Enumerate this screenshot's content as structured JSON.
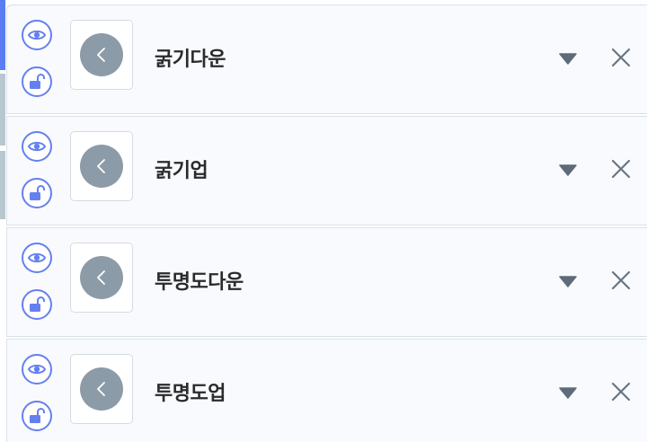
{
  "layers": [
    {
      "label": "굵기다운",
      "visible_icon": "eye-icon",
      "lock_icon": "unlock-icon",
      "thumb_icon": "chevron-left-icon"
    },
    {
      "label": "굵기업",
      "visible_icon": "eye-icon",
      "lock_icon": "unlock-icon",
      "thumb_icon": "chevron-left-icon"
    },
    {
      "label": "투명도다운",
      "visible_icon": "eye-icon",
      "lock_icon": "unlock-icon",
      "thumb_icon": "chevron-left-icon"
    },
    {
      "label": "투명도업",
      "visible_icon": "eye-icon",
      "lock_icon": "unlock-icon",
      "thumb_icon": "chevron-left-icon"
    }
  ],
  "colors": {
    "accent": "#5b7cf5",
    "icon_blue": "#6480f0",
    "thumb_circle": "#8c9ba8",
    "dropdown": "#5f6b78",
    "close": "#6b7580"
  }
}
